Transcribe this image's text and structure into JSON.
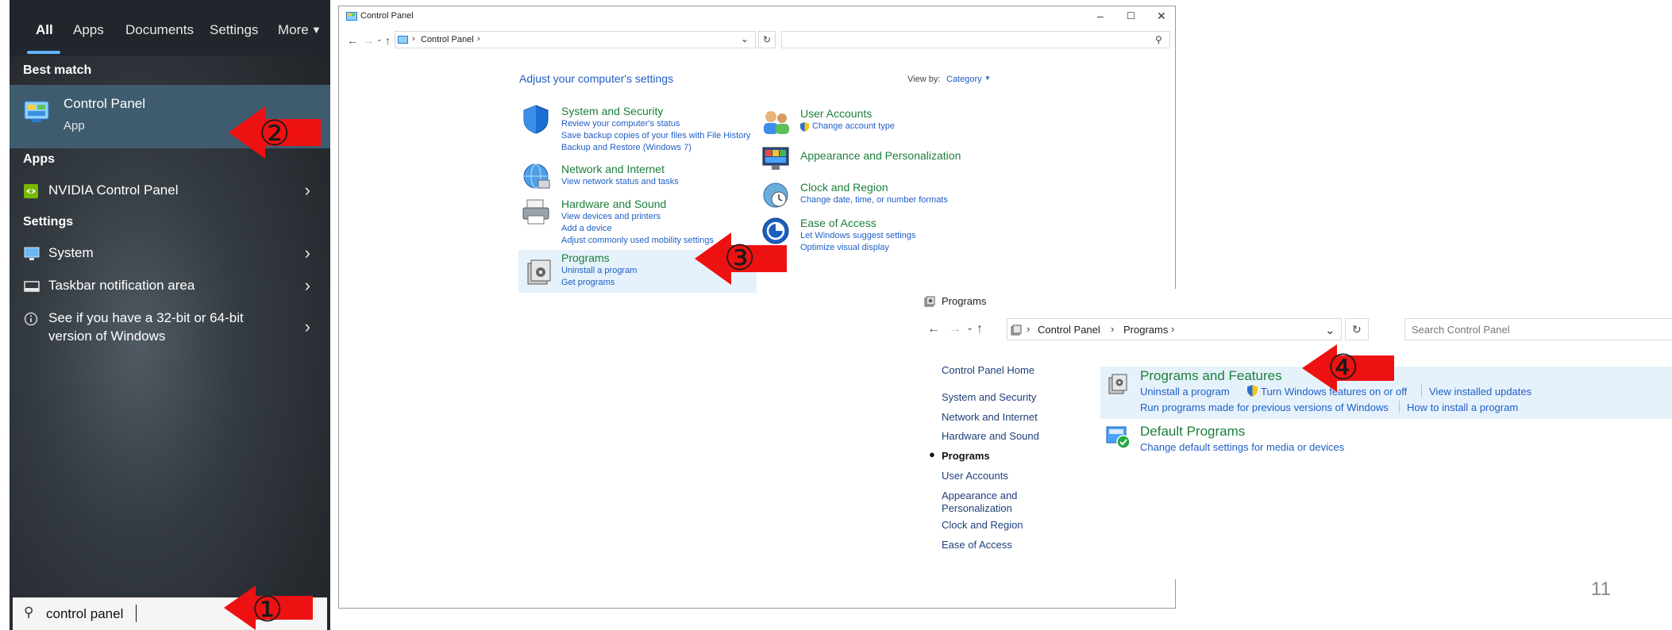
{
  "start": {
    "tabs": [
      {
        "label": "All",
        "active": true
      },
      {
        "label": "Apps"
      },
      {
        "label": "Documents"
      },
      {
        "label": "Settings"
      },
      {
        "label": "More"
      }
    ],
    "best_match_label": "Best match",
    "best_match": {
      "title": "Control Panel",
      "subtitle": "App",
      "icon": "control-panel-icon"
    },
    "apps_label": "Apps",
    "apps": [
      {
        "label": "NVIDIA Control Panel",
        "icon": "nvidia-icon"
      }
    ],
    "settings_label": "Settings",
    "settings": [
      {
        "label": "System",
        "icon": "monitor-icon"
      },
      {
        "label": "Taskbar notification area",
        "icon": "taskbar-icon"
      },
      {
        "label": "See if you have a 32-bit or 64-bit",
        "label2": "version of Windows",
        "icon": "info-icon"
      }
    ],
    "search_value": "control panel"
  },
  "control_panel": {
    "title": "Control Panel",
    "breadcrumb": "Control Panel",
    "heading": "Adjust your computer's settings",
    "view_by_label": "View by:",
    "view_by_value": "Category",
    "categories_left": [
      {
        "title": "System and Security",
        "links": [
          "Review your computer's status",
          "Save backup copies of your files with File History",
          "Backup and Restore (Windows 7)"
        ]
      },
      {
        "title": "Network and Internet",
        "links": [
          "View network status and tasks"
        ]
      },
      {
        "title": "Hardware and Sound",
        "links": [
          "View devices and printers",
          "Add a device",
          "Adjust commonly used mobility settings"
        ]
      },
      {
        "title": "Programs",
        "links": [
          "Uninstall a program",
          "Get programs"
        ]
      }
    ],
    "categories_right": [
      {
        "title": "User Accounts",
        "links": [
          "Change account type"
        ]
      },
      {
        "title": "Appearance and Personalization",
        "links": []
      },
      {
        "title": "Clock and Region",
        "links": [
          "Change date, time, or number formats"
        ]
      },
      {
        "title": "Ease of Access",
        "links": [
          "Let Windows suggest settings",
          "Optimize visual display"
        ]
      }
    ]
  },
  "programs": {
    "title": "Programs",
    "breadcrumb": [
      "Control Panel",
      "Programs"
    ],
    "search_placeholder": "Search Control Panel",
    "nav": [
      {
        "label": "Control Panel Home"
      },
      {
        "label": "System and Security"
      },
      {
        "label": "Network and Internet"
      },
      {
        "label": "Hardware and Sound"
      },
      {
        "label": "Programs",
        "current": true
      },
      {
        "label": "User Accounts"
      },
      {
        "label": "Appearance and"
      },
      {
        "label": "Personalization"
      },
      {
        "label": "Clock and Region"
      },
      {
        "label": "Ease of Access"
      }
    ],
    "sections": [
      {
        "title": "Programs and Features",
        "links_row1": [
          "Uninstall a program",
          "Turn Windows features on or off",
          "View installed updates"
        ],
        "links_row2": [
          "Run programs made for previous versions of Windows",
          "How to install a program"
        ]
      },
      {
        "title": "Default Programs",
        "links_row1": [
          "Change default settings for media or devices"
        ]
      }
    ]
  },
  "annotations": [
    "①",
    "②",
    "③",
    "④"
  ],
  "page_number": "11",
  "colors": {
    "annotation_arrow": "#ee1111",
    "link_blue": "#1f5ec7",
    "category_green": "#1c7f3a",
    "accent": "#2f7fd0"
  }
}
